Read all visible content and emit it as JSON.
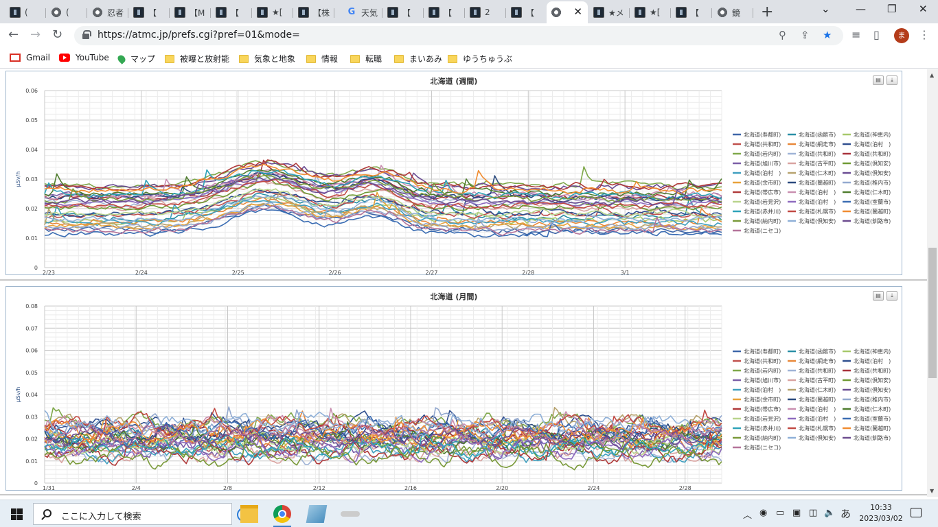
{
  "browser": {
    "tabs": [
      {
        "icon": "dark",
        "label": "(",
        "x": 8,
        "w": 58
      },
      {
        "icon": "globe",
        "label": "(",
        "x": 68,
        "w": 58
      },
      {
        "icon": "globe",
        "label": "忍者",
        "x": 128,
        "w": 58
      },
      {
        "icon": "dark",
        "label": "【",
        "x": 188,
        "w": 58
      },
      {
        "icon": "dark",
        "label": "【M",
        "x": 248,
        "w": 58
      },
      {
        "icon": "dark",
        "label": "【",
        "x": 308,
        "w": 58
      },
      {
        "icon": "dark",
        "label": "★[",
        "x": 368,
        "w": 58
      },
      {
        "icon": "dark",
        "label": "【株",
        "x": 428,
        "w": 58
      },
      {
        "icon": "g",
        "label": "天気",
        "x": 498,
        "w": 58
      },
      {
        "icon": "dark",
        "label": "【",
        "x": 558,
        "w": 58
      },
      {
        "icon": "dark",
        "label": "【",
        "x": 618,
        "w": 58
      },
      {
        "icon": "dark",
        "label": "2",
        "x": 678,
        "w": 58
      },
      {
        "icon": "dark",
        "label": "【",
        "x": 738,
        "w": 58
      },
      {
        "icon": "globe",
        "label": "",
        "x": 796,
        "w": 60,
        "active": true
      },
      {
        "icon": "dark",
        "label": "★メ",
        "x": 858,
        "w": 58
      },
      {
        "icon": "dark",
        "label": "★[",
        "x": 918,
        "w": 58
      },
      {
        "icon": "dark",
        "label": "【",
        "x": 978,
        "w": 58
      },
      {
        "icon": "globe",
        "label": "鏡",
        "x": 1038,
        "w": 58
      }
    ],
    "url": "https://atmc.jp/prefs.cgi?pref=01&mode=",
    "avatar_letter": "ま",
    "bookmarks": [
      {
        "icon": "gmail",
        "label": "Gmail",
        "x": 14
      },
      {
        "icon": "youtube",
        "label": "YouTube",
        "x": 86
      },
      {
        "icon": "maps",
        "label": "マップ",
        "x": 172
      },
      {
        "icon": "folder",
        "label": "被曝と放射能",
        "x": 240
      },
      {
        "icon": "folder",
        "label": "気象と地象",
        "x": 348
      },
      {
        "icon": "folder",
        "label": "情報",
        "x": 446
      },
      {
        "icon": "folder",
        "label": "転職",
        "x": 510
      },
      {
        "icon": "folder",
        "label": "まいあみ",
        "x": 574
      },
      {
        "icon": "folder",
        "label": "ゆうちゅうぶ",
        "x": 652
      }
    ]
  },
  "charts": [
    {
      "title": "北海道 (週間)",
      "ylabel": "μSv/h",
      "ylim": [
        0,
        0.06
      ],
      "yticks": [
        "0",
        "0.01",
        "0.02",
        "0.03",
        "0.04",
        "0.05",
        "0.06"
      ],
      "xticks": [
        "2/23",
        "2/24",
        "2/25",
        "2/26",
        "2/27",
        "2/28",
        "3/1"
      ]
    },
    {
      "title": "北海道 (月間)",
      "ylabel": "μSv/h",
      "ylim": [
        0,
        0.08
      ],
      "yticks": [
        "0",
        "0.01",
        "0.02",
        "0.03",
        "0.04",
        "0.05",
        "0.06",
        "0.07",
        "0.08"
      ],
      "xticks": [
        "1/31",
        "2/4",
        "2/8",
        "2/12",
        "2/16",
        "2/20",
        "2/24",
        "2/28"
      ]
    }
  ],
  "legend": [
    {
      "name": "北海道(寿都町)",
      "color": "#3e66a8"
    },
    {
      "name": "北海道(函館市)",
      "color": "#2a8fa6"
    },
    {
      "name": "北海道(神恵内)",
      "color": "#a6c86b"
    },
    {
      "name": "北海道(共和町)",
      "color": "#c0504d"
    },
    {
      "name": "北海道(網走市)",
      "color": "#e8883a"
    },
    {
      "name": "北海道(泊村　)",
      "color": "#2f4f8f"
    },
    {
      "name": "北海道(岩内町)",
      "color": "#7fa84a"
    },
    {
      "name": "北海道(共和町)",
      "color": "#9fb3d6"
    },
    {
      "name": "北海道(共和町)",
      "color": "#a8323c"
    },
    {
      "name": "北海道(旭川市)",
      "color": "#7b5ea7"
    },
    {
      "name": "北海道(古平町)",
      "color": "#d9a3a0"
    },
    {
      "name": "北海道(倶知安)",
      "color": "#6f9a33"
    },
    {
      "name": "北海道(泊村　)",
      "color": "#3f9fbf"
    },
    {
      "name": "北海道(仁木町)",
      "color": "#b7a36e"
    },
    {
      "name": "北海道(倶知安)",
      "color": "#6a4c93"
    },
    {
      "name": "北海道(余市町)",
      "color": "#e8a23a"
    },
    {
      "name": "北海道(蘭越町)",
      "color": "#2b4a7e"
    },
    {
      "name": "北海道(稚内市)",
      "color": "#93a9cf"
    },
    {
      "name": "北海道(帯広市)",
      "color": "#b03a3a"
    },
    {
      "name": "北海道(泊村　)",
      "color": "#c98fb0"
    },
    {
      "name": "北海道(仁木町)",
      "color": "#4f7d2e"
    },
    {
      "name": "北海道(岩見沢)",
      "color": "#b8d48c"
    },
    {
      "name": "北海道(泊村　)",
      "color": "#8e6bbf"
    },
    {
      "name": "北海道(室蘭市)",
      "color": "#3b6db3"
    },
    {
      "name": "北海道(赤井川)",
      "color": "#2ea3b8"
    },
    {
      "name": "北海道(札幌市)",
      "color": "#c24a44"
    },
    {
      "name": "北海道(蘭越町)",
      "color": "#f08c30"
    },
    {
      "name": "北海道(納内町)",
      "color": "#7a9a3a"
    },
    {
      "name": "北海道(倶知安)",
      "color": "#8fb0d8"
    },
    {
      "name": "北海道(釧路市)",
      "color": "#6d4c8f"
    },
    {
      "name": "北海道(ニセコ)",
      "color": "#b5749a"
    }
  ],
  "taskbar": {
    "search_placeholder": "ここに入力して検索",
    "time": "10:33",
    "date": "2023/03/02",
    "ime": "あ"
  }
}
